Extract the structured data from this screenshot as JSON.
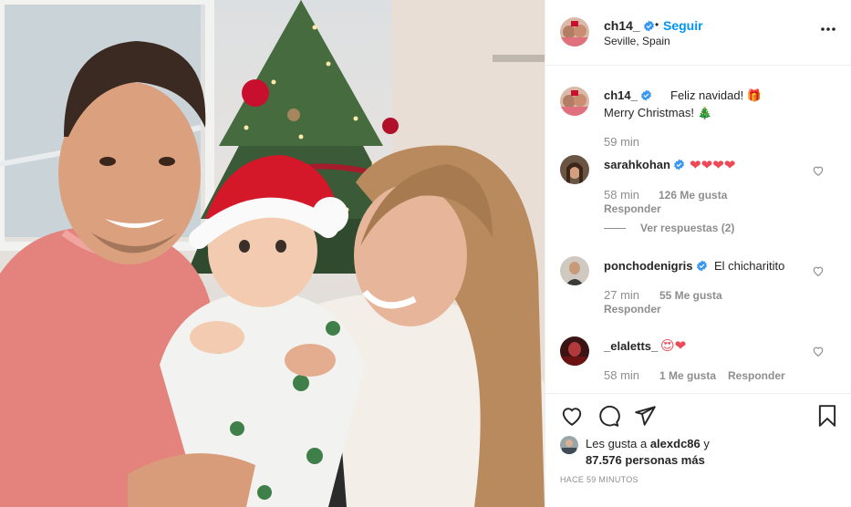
{
  "post": {
    "author": "ch14_",
    "follow_label": "Seguir",
    "separator": "•",
    "location": "Seville, Spain"
  },
  "caption": {
    "user": "ch14_",
    "line1": "Feliz navidad! 🎁",
    "line2": "Merry Christmas! 🎄",
    "time": "59 min"
  },
  "comments": [
    {
      "user": "sarahkohan",
      "text": "❤❤❤❤",
      "time": "58 min",
      "likes": "126 Me gusta",
      "reply": "Responder",
      "view_replies": "Ver respuestas (2)"
    },
    {
      "user": "ponchodenigris",
      "text": "El chicharitito",
      "time": "27 min",
      "likes": "55 Me gusta",
      "reply": "Responder"
    },
    {
      "user": "_elaletts_",
      "text": "😍❤",
      "time": "58 min",
      "likes": "1 Me gusta",
      "reply": "Responder"
    }
  ],
  "likes": {
    "prefix": "Les gusta a ",
    "user": "alexdc86",
    "middle": " y",
    "count": "87.576 personas más"
  },
  "posted": "HACE 59 MINUTOS",
  "colors": {
    "link_blue": "#0095f6",
    "verified_blue": "#3897f0",
    "muted": "#8e8e8e",
    "heart_red": "#ed4956"
  },
  "icons": [
    "verified-icon",
    "more-options-icon",
    "heart-icon",
    "comment-icon",
    "share-icon",
    "bookmark-icon"
  ]
}
